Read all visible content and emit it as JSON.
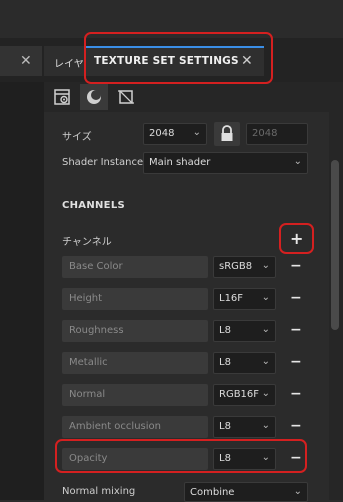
{
  "tabs": {
    "left_close": "✕",
    "layer_label": "レイヤ",
    "active_label": "TEXTURE SET SETTINGS",
    "active_close": "✕"
  },
  "toolbar": {
    "icons": [
      "settings-icon",
      "material-ball-icon",
      "uv-crop-icon"
    ]
  },
  "size": {
    "label": "サイズ",
    "value": "2048",
    "linked_value": "2048"
  },
  "shader": {
    "label": "Shader Instance",
    "value": "Main shader"
  },
  "channels": {
    "heading": "CHANNELS",
    "add_label": "チャンネル",
    "add_button": "+",
    "remove_button": "−",
    "items": [
      {
        "name": "Base Color",
        "format": "sRGB8"
      },
      {
        "name": "Height",
        "format": "L16F"
      },
      {
        "name": "Roughness",
        "format": "L8"
      },
      {
        "name": "Metallic",
        "format": "L8"
      },
      {
        "name": "Normal",
        "format": "RGB16F"
      },
      {
        "name": "Ambient occlusion",
        "format": "L8"
      },
      {
        "name": "Opacity",
        "format": "L8"
      }
    ]
  },
  "normal_mixing": {
    "label": "Normal mixing",
    "value": "Combine"
  },
  "colors": {
    "accent": "#3a8ee6",
    "highlight": "#d42020"
  }
}
